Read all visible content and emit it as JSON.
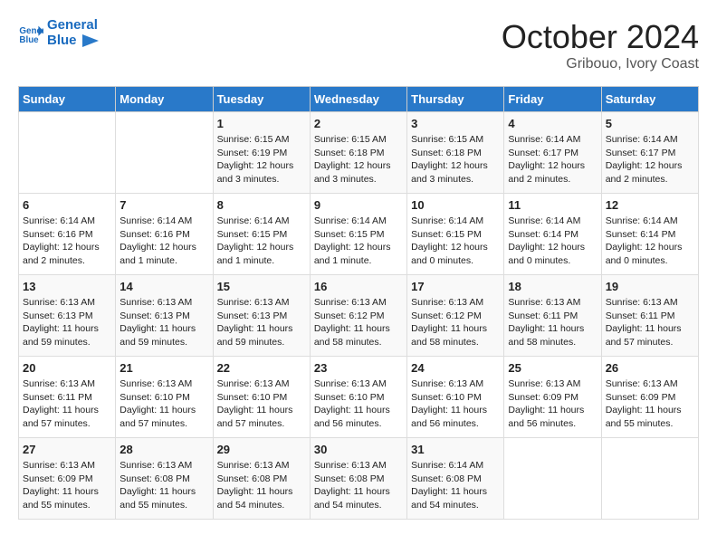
{
  "header": {
    "logo_line1": "General",
    "logo_line2": "Blue",
    "month": "October 2024",
    "location": "Gribouo, Ivory Coast"
  },
  "days_of_week": [
    "Sunday",
    "Monday",
    "Tuesday",
    "Wednesday",
    "Thursday",
    "Friday",
    "Saturday"
  ],
  "weeks": [
    [
      {
        "day": "",
        "content": ""
      },
      {
        "day": "",
        "content": ""
      },
      {
        "day": "1",
        "content": "Sunrise: 6:15 AM\nSunset: 6:19 PM\nDaylight: 12 hours and 3 minutes."
      },
      {
        "day": "2",
        "content": "Sunrise: 6:15 AM\nSunset: 6:18 PM\nDaylight: 12 hours and 3 minutes."
      },
      {
        "day": "3",
        "content": "Sunrise: 6:15 AM\nSunset: 6:18 PM\nDaylight: 12 hours and 3 minutes."
      },
      {
        "day": "4",
        "content": "Sunrise: 6:14 AM\nSunset: 6:17 PM\nDaylight: 12 hours and 2 minutes."
      },
      {
        "day": "5",
        "content": "Sunrise: 6:14 AM\nSunset: 6:17 PM\nDaylight: 12 hours and 2 minutes."
      }
    ],
    [
      {
        "day": "6",
        "content": "Sunrise: 6:14 AM\nSunset: 6:16 PM\nDaylight: 12 hours and 2 minutes."
      },
      {
        "day": "7",
        "content": "Sunrise: 6:14 AM\nSunset: 6:16 PM\nDaylight: 12 hours and 1 minute."
      },
      {
        "day": "8",
        "content": "Sunrise: 6:14 AM\nSunset: 6:15 PM\nDaylight: 12 hours and 1 minute."
      },
      {
        "day": "9",
        "content": "Sunrise: 6:14 AM\nSunset: 6:15 PM\nDaylight: 12 hours and 1 minute."
      },
      {
        "day": "10",
        "content": "Sunrise: 6:14 AM\nSunset: 6:15 PM\nDaylight: 12 hours and 0 minutes."
      },
      {
        "day": "11",
        "content": "Sunrise: 6:14 AM\nSunset: 6:14 PM\nDaylight: 12 hours and 0 minutes."
      },
      {
        "day": "12",
        "content": "Sunrise: 6:14 AM\nSunset: 6:14 PM\nDaylight: 12 hours and 0 minutes."
      }
    ],
    [
      {
        "day": "13",
        "content": "Sunrise: 6:13 AM\nSunset: 6:13 PM\nDaylight: 11 hours and 59 minutes."
      },
      {
        "day": "14",
        "content": "Sunrise: 6:13 AM\nSunset: 6:13 PM\nDaylight: 11 hours and 59 minutes."
      },
      {
        "day": "15",
        "content": "Sunrise: 6:13 AM\nSunset: 6:13 PM\nDaylight: 11 hours and 59 minutes."
      },
      {
        "day": "16",
        "content": "Sunrise: 6:13 AM\nSunset: 6:12 PM\nDaylight: 11 hours and 58 minutes."
      },
      {
        "day": "17",
        "content": "Sunrise: 6:13 AM\nSunset: 6:12 PM\nDaylight: 11 hours and 58 minutes."
      },
      {
        "day": "18",
        "content": "Sunrise: 6:13 AM\nSunset: 6:11 PM\nDaylight: 11 hours and 58 minutes."
      },
      {
        "day": "19",
        "content": "Sunrise: 6:13 AM\nSunset: 6:11 PM\nDaylight: 11 hours and 57 minutes."
      }
    ],
    [
      {
        "day": "20",
        "content": "Sunrise: 6:13 AM\nSunset: 6:11 PM\nDaylight: 11 hours and 57 minutes."
      },
      {
        "day": "21",
        "content": "Sunrise: 6:13 AM\nSunset: 6:10 PM\nDaylight: 11 hours and 57 minutes."
      },
      {
        "day": "22",
        "content": "Sunrise: 6:13 AM\nSunset: 6:10 PM\nDaylight: 11 hours and 57 minutes."
      },
      {
        "day": "23",
        "content": "Sunrise: 6:13 AM\nSunset: 6:10 PM\nDaylight: 11 hours and 56 minutes."
      },
      {
        "day": "24",
        "content": "Sunrise: 6:13 AM\nSunset: 6:10 PM\nDaylight: 11 hours and 56 minutes."
      },
      {
        "day": "25",
        "content": "Sunrise: 6:13 AM\nSunset: 6:09 PM\nDaylight: 11 hours and 56 minutes."
      },
      {
        "day": "26",
        "content": "Sunrise: 6:13 AM\nSunset: 6:09 PM\nDaylight: 11 hours and 55 minutes."
      }
    ],
    [
      {
        "day": "27",
        "content": "Sunrise: 6:13 AM\nSunset: 6:09 PM\nDaylight: 11 hours and 55 minutes."
      },
      {
        "day": "28",
        "content": "Sunrise: 6:13 AM\nSunset: 6:08 PM\nDaylight: 11 hours and 55 minutes."
      },
      {
        "day": "29",
        "content": "Sunrise: 6:13 AM\nSunset: 6:08 PM\nDaylight: 11 hours and 54 minutes."
      },
      {
        "day": "30",
        "content": "Sunrise: 6:13 AM\nSunset: 6:08 PM\nDaylight: 11 hours and 54 minutes."
      },
      {
        "day": "31",
        "content": "Sunrise: 6:14 AM\nSunset: 6:08 PM\nDaylight: 11 hours and 54 minutes."
      },
      {
        "day": "",
        "content": ""
      },
      {
        "day": "",
        "content": ""
      }
    ]
  ]
}
